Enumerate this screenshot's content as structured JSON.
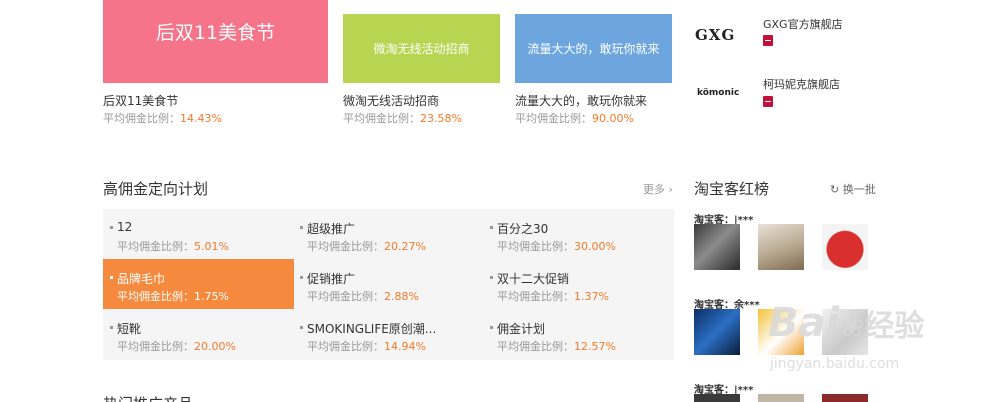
{
  "promo_cards": [
    {
      "banner_text": "后双11美食节",
      "title": "后双11美食节",
      "ratio_label": "平均佣金比例：",
      "ratio_value": "14.43%",
      "color": "#f57489"
    },
    {
      "banner_text": "微淘无线活动招商",
      "title": "微淘无线活动招商",
      "ratio_label": "平均佣金比例：",
      "ratio_value": "23.58%",
      "color": "#b8d552"
    },
    {
      "banner_text": "流量大大的，敢玩你就来",
      "title": "流量大大的，敢玩你就来",
      "ratio_label": "平均佣金比例：",
      "ratio_value": "90.00%",
      "color": "#6da6df"
    }
  ],
  "brand_shops": [
    {
      "logo": "GXG",
      "name": "GXG官方旗舰店"
    },
    {
      "logo": "kömonic",
      "name": "柯玛妮克旗舰店"
    }
  ],
  "plan_section": {
    "title": "高佣金定向计划",
    "more_label": "更多 ›",
    "ratio_label": "平均佣金比例：",
    "items": [
      {
        "name": "12",
        "ratio": "5.01%"
      },
      {
        "name": "超级推广",
        "ratio": "20.27%"
      },
      {
        "name": "百分之30",
        "ratio": "30.00%"
      },
      {
        "name": "品牌毛巾",
        "ratio": "1.75%"
      },
      {
        "name": "促销推广",
        "ratio": "2.88%"
      },
      {
        "name": "双十二大促销",
        "ratio": "1.37%"
      },
      {
        "name": "短靴",
        "ratio": "20.00%"
      },
      {
        "name": "SMOKINGLIFE原创潮...",
        "ratio": "14.94%"
      },
      {
        "name": "佣金计划",
        "ratio": "12.57%"
      }
    ],
    "active_index": 3
  },
  "hot_list": {
    "title": "淘宝客红榜",
    "refresh_label": "换一批",
    "users": [
      "淘宝客：|***",
      "淘宝客：余***",
      "淘宝客：|***"
    ]
  },
  "bottom_section": {
    "title": "热门推广产品"
  },
  "watermark": {
    "brand": "Bai",
    "brand_tail": "经验",
    "url": "jingyan.baidu.com"
  },
  "colors": {
    "accent": "#f37a2a",
    "active": "#f58a3e",
    "tmall": "#c2113c"
  }
}
